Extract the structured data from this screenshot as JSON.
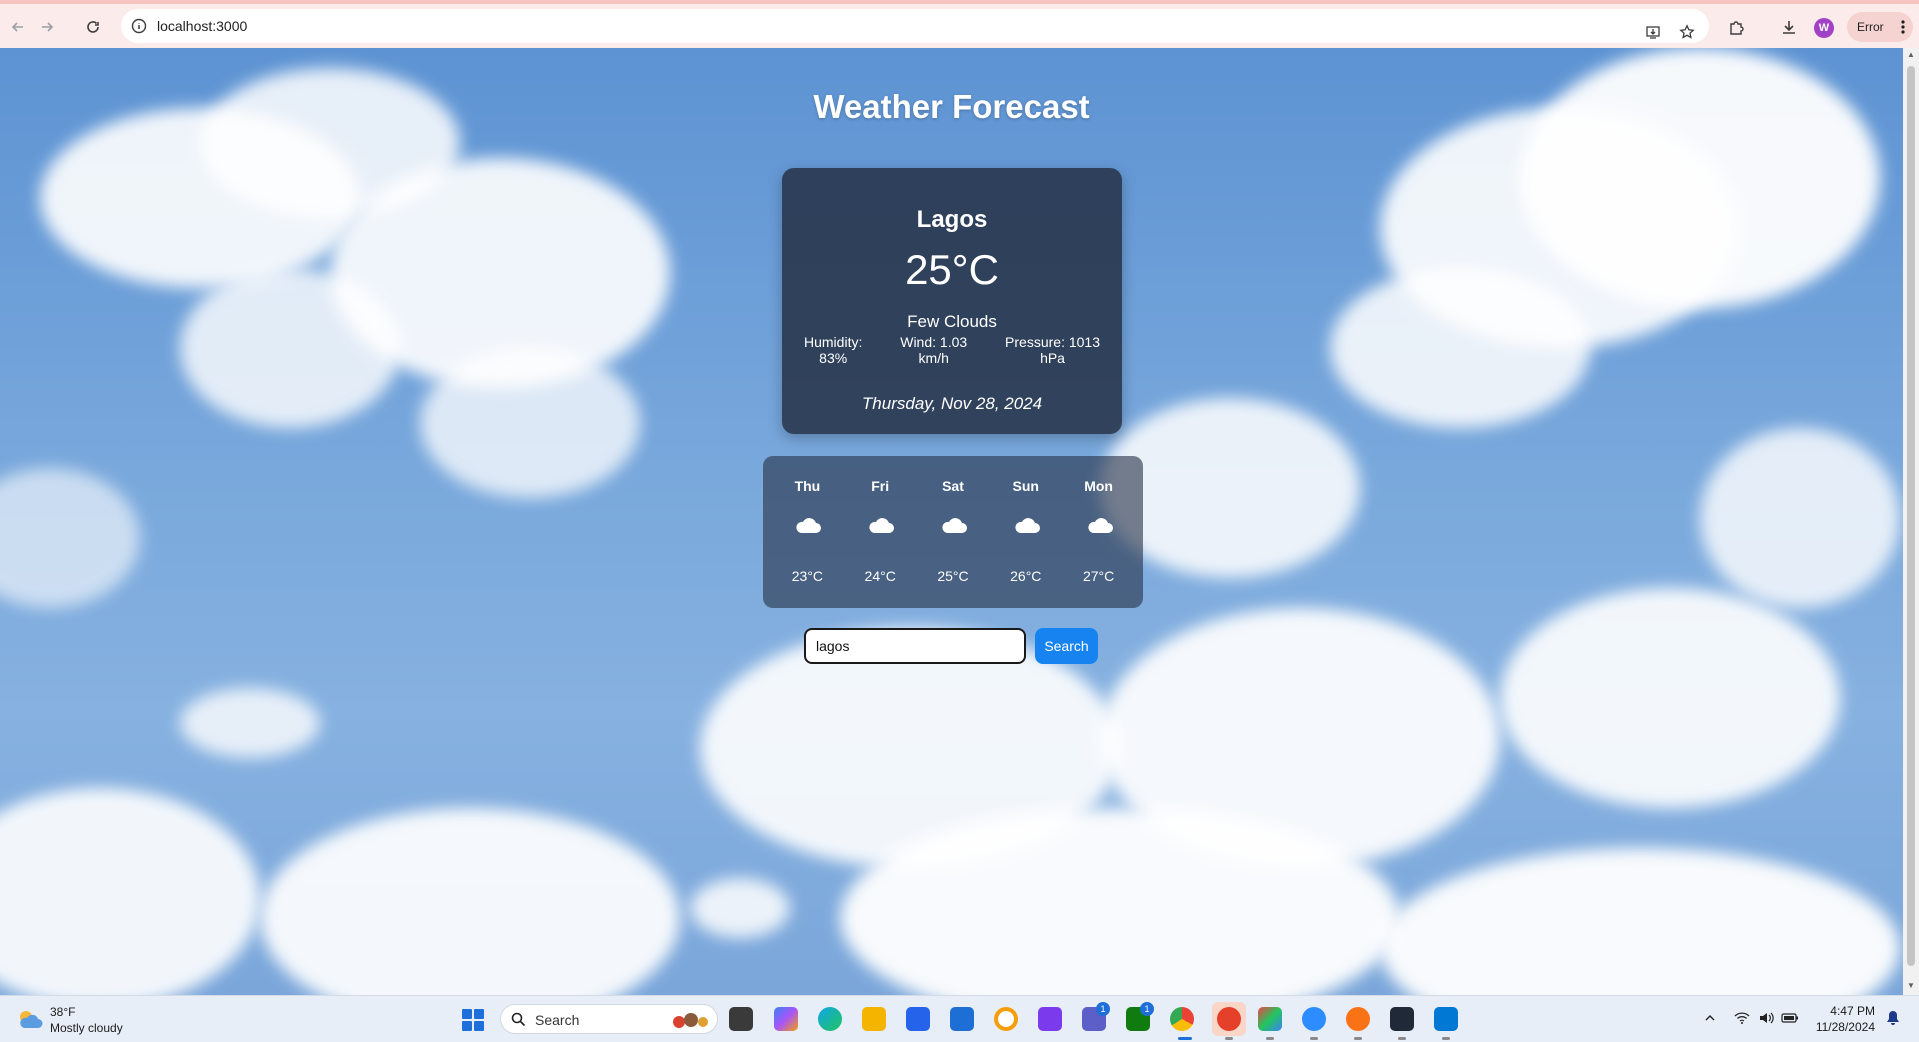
{
  "browser": {
    "url": "localhost:3000",
    "profile_initial": "W",
    "status_label": "Error"
  },
  "page": {
    "title": "Weather Forecast",
    "current": {
      "city": "Lagos",
      "temperature": "25°C",
      "description": "Few Clouds",
      "humidity_label": "Humidity:",
      "humidity_value": "83%",
      "wind_label": "Wind: 1.03",
      "wind_unit": "km/h",
      "pressure_label": "Pressure: 1013",
      "pressure_unit": "hPa",
      "date": "Thursday, Nov 28, 2024"
    },
    "forecast": [
      {
        "day": "Thu",
        "temp": "23°C",
        "icon": "cloud-icon"
      },
      {
        "day": "Fri",
        "temp": "24°C",
        "icon": "cloud-icon"
      },
      {
        "day": "Sat",
        "temp": "25°C",
        "icon": "cloud-icon"
      },
      {
        "day": "Sun",
        "temp": "26°C",
        "icon": "cloud-icon"
      },
      {
        "day": "Mon",
        "temp": "27°C",
        "icon": "cloud-icon"
      }
    ],
    "search": {
      "value": "lagos",
      "button_label": "Search"
    }
  },
  "taskbar": {
    "weather_temp": "38°F",
    "weather_condition": "Mostly cloudy",
    "search_placeholder": "Search",
    "teams_badge": "1",
    "xbox_badge": "1",
    "time": "4:47 PM",
    "date": "11/28/2024"
  },
  "colors": {
    "accent": "#1683f0",
    "card_bg": "#222c40",
    "sky": "#79a8dc"
  }
}
